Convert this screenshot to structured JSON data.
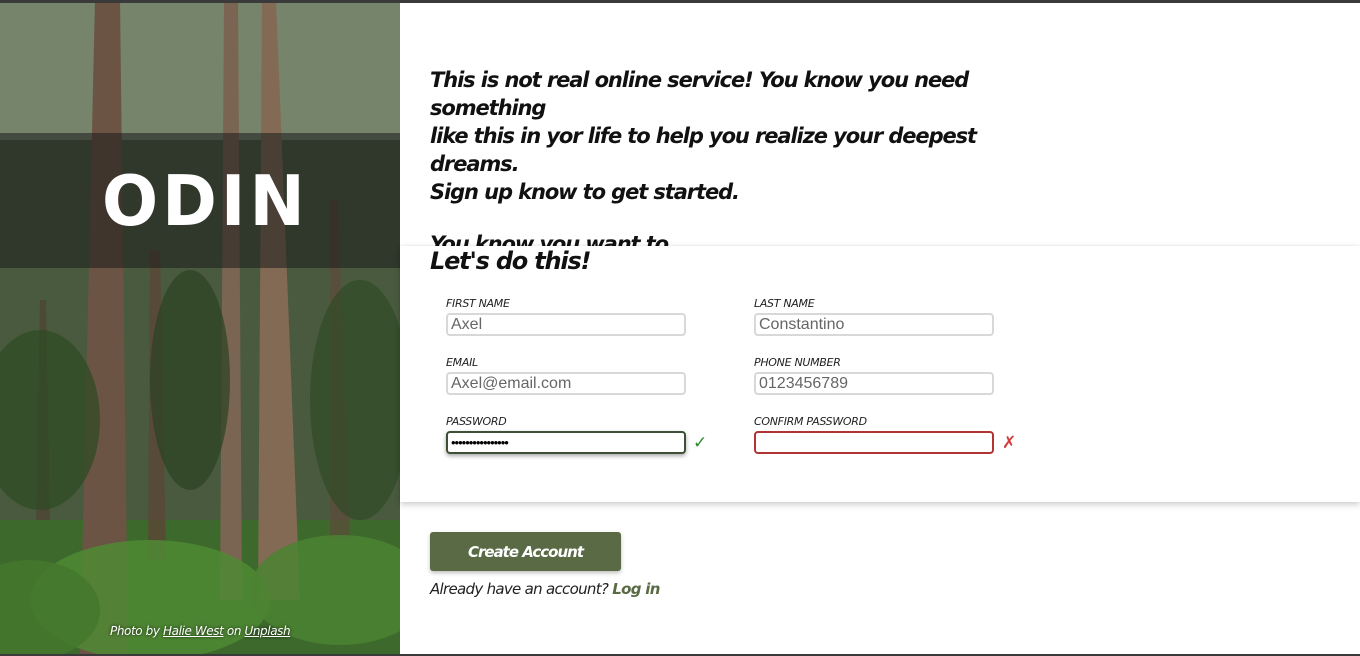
{
  "brand": {
    "name": "ODIN",
    "logo_icon": "dog-head-icon"
  },
  "photo_credit": {
    "prefix": "Photo by",
    "author": "Halie West",
    "middle": "on",
    "site": "Unplash"
  },
  "intro": {
    "line1": "This is not real online service! You know you need something",
    "line2": "like this in yor life to help you realize your deepest dreams.",
    "line3": "Sign up know to get started.",
    "line4": "You know you want to."
  },
  "form": {
    "title": "Let's do this!",
    "first_name": {
      "label": "FIRST NAME",
      "value": "Axel"
    },
    "last_name": {
      "label": "LAST NAME",
      "value": "Constantino"
    },
    "email": {
      "label": "EMAIL",
      "value": "Axel@email.com"
    },
    "phone": {
      "label": "PHONE NUMBER",
      "value": "0123456789"
    },
    "password": {
      "label": "PASSWORD",
      "value": "••••••••••••••••",
      "status_icon": "checkmark-icon",
      "status_glyph": "✓"
    },
    "confirm_password": {
      "label": "CONFIRM PASSWORD",
      "value": "",
      "status_icon": "cross-icon",
      "status_glyph": "✗"
    }
  },
  "actions": {
    "create_label": "Create Account",
    "login_prompt": "Already have an account?",
    "login_link": "Log in"
  },
  "colors": {
    "accent": "#596a45",
    "valid": "#2f8a2f",
    "invalid": "#d23c3c"
  }
}
